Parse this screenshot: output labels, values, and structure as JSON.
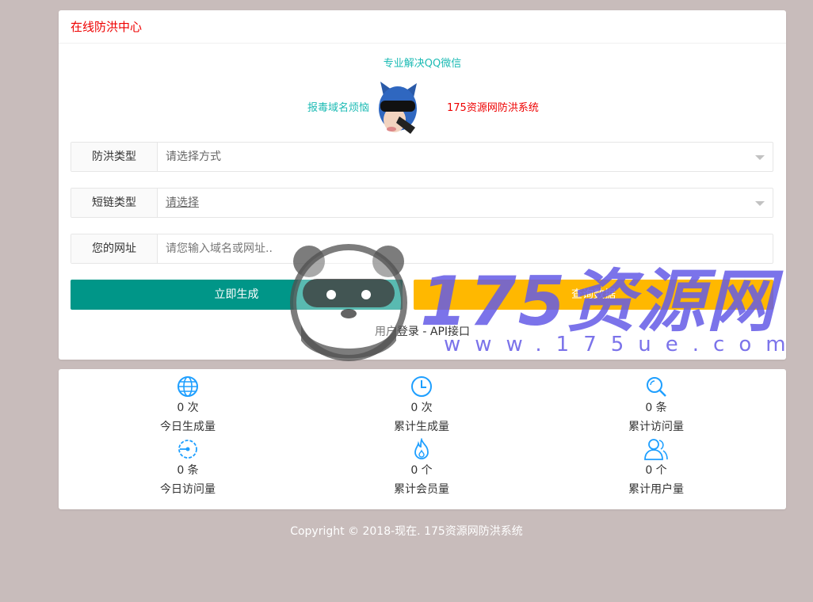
{
  "header": {
    "title": "在线防洪中心"
  },
  "promo": {
    "top": "专业解决QQ微信",
    "left": "报毒域名烦恼",
    "right": "175资源网防洪系统"
  },
  "form": {
    "type_label": "防洪类型",
    "type_value": "请选择方式",
    "short_label": "短链类型",
    "short_value": "请选择",
    "url_label": "您的网址",
    "url_placeholder": "请您输入域名或网址.."
  },
  "buttons": {
    "generate": "立即生成",
    "query": "查询数据"
  },
  "links": {
    "login": "用户登录",
    "separator": " - ",
    "api": "API接口"
  },
  "stats": [
    {
      "icon": "globe-icon",
      "value": "0 次",
      "label": "今日生成量"
    },
    {
      "icon": "clock-icon",
      "value": "0 次",
      "label": "累计生成量"
    },
    {
      "icon": "search-icon",
      "value": "0 条",
      "label": "累计访问量"
    },
    {
      "icon": "gauge-icon",
      "value": "0 条",
      "label": "今日访问量"
    },
    {
      "icon": "fire-icon",
      "value": "0 个",
      "label": "累计会员量"
    },
    {
      "icon": "users-icon",
      "value": "0 个",
      "label": "累计用户量"
    }
  ],
  "footer": {
    "copyright": "Copyright © 2018-现在. 175资源网防洪系统"
  },
  "watermark": {
    "brand": "175资源网",
    "url": "www.175ue.com"
  },
  "colors": {
    "accent_red": "#ee0000",
    "teal_text": "#1cbbb4",
    "generate_btn": "#009688",
    "query_btn": "#ffb800",
    "icon_blue": "#1e9fff"
  }
}
